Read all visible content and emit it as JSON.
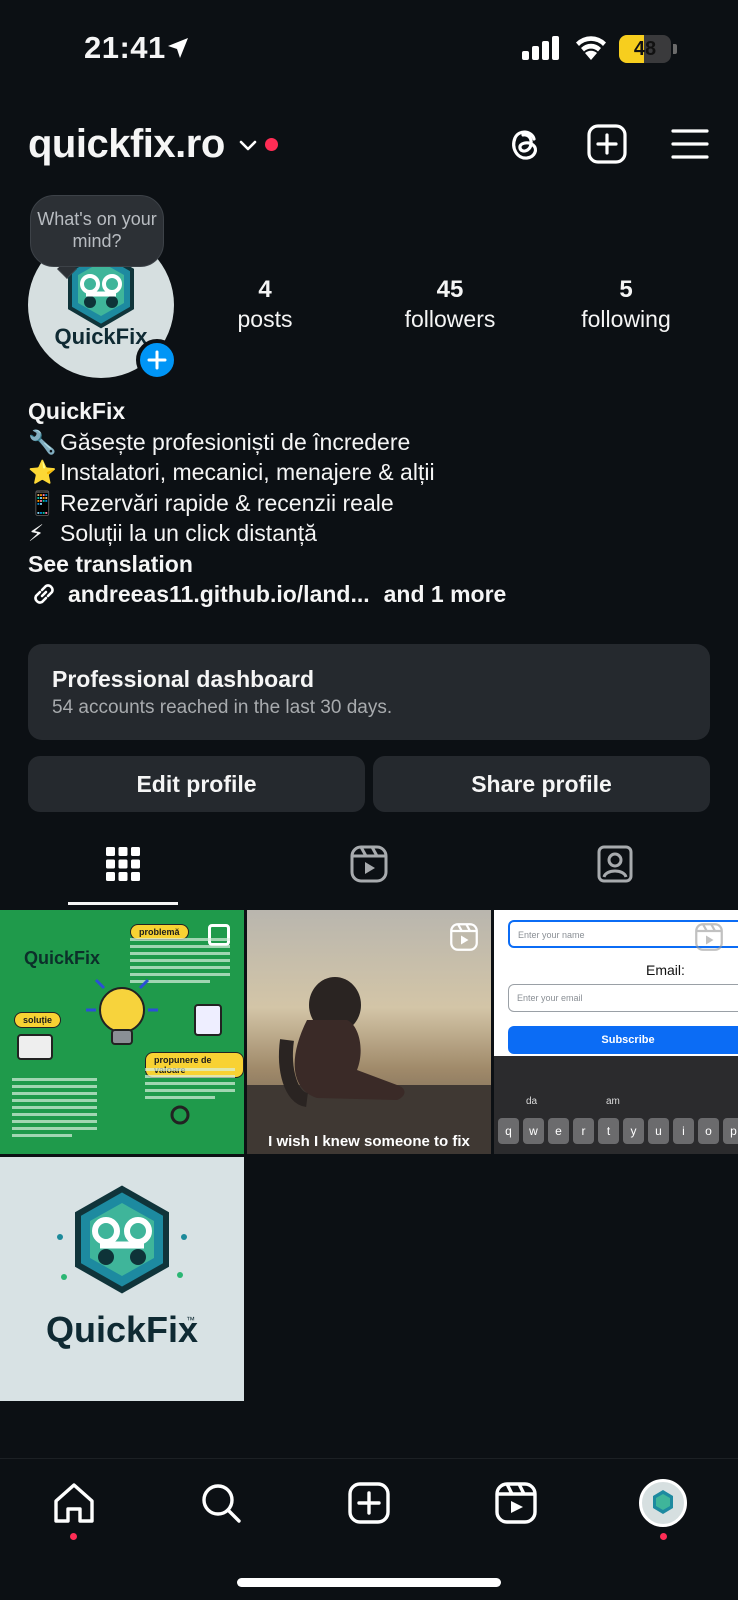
{
  "status_bar": {
    "time": "21:41",
    "battery": "48",
    "battery_level": 0.48
  },
  "header": {
    "username": "quickfix.ro",
    "icons": [
      "threads-icon",
      "create-icon",
      "menu-icon"
    ]
  },
  "profile": {
    "note_bubble": "What's on your mind?",
    "avatar_text": "QuickFix",
    "stats": [
      {
        "value": "4",
        "label": "posts"
      },
      {
        "value": "45",
        "label": "followers"
      },
      {
        "value": "5",
        "label": "following"
      }
    ],
    "name": "QuickFix",
    "bio": [
      {
        "emoji": "🔧",
        "text": "Găsește profesioniști de încredere"
      },
      {
        "emoji": "⭐",
        "text": "Instalatori, mecanici, menajere & alții"
      },
      {
        "emoji": "📱",
        "text": "Rezervări rapide & recenzii reale"
      },
      {
        "emoji": "⚡",
        "text": "Soluții la un click distanță"
      }
    ],
    "see_translation": "See translation",
    "link": "andreeas11.github.io/land...",
    "link_more": "and 1 more"
  },
  "dashboard": {
    "title": "Professional dashboard",
    "subtitle": "54 accounts reached in the last 30 days."
  },
  "buttons": {
    "edit": "Edit profile",
    "share": "Share profile"
  },
  "tabs": [
    "grid-icon",
    "reels-icon",
    "tagged-icon"
  ],
  "posts": {
    "p1": {
      "title": "QuickFix",
      "tag_problem": "problemă",
      "tag_solution": "soluție",
      "tag_value": "propunere de valoare"
    },
    "p2": {
      "caption": "I wish I knew someone to fix"
    },
    "p3": {
      "name_placeholder": "Enter your name",
      "email_label": "Email:",
      "email_placeholder": "Enter your email",
      "submit": "Subscribe",
      "suggestion_1": "da",
      "suggestion_2": "am",
      "keys": [
        "q",
        "w",
        "e",
        "r",
        "t",
        "y",
        "u",
        "i",
        "o",
        "p"
      ]
    },
    "p4": {
      "logo_text": "QuickFix",
      "tm": "™"
    }
  },
  "nav": [
    "home-icon",
    "search-icon",
    "create-icon",
    "reels-icon",
    "profile-avatar"
  ],
  "colors": {
    "accent": "#0095f6",
    "notification": "#ff2d55",
    "battery": "#f7ce1e"
  }
}
